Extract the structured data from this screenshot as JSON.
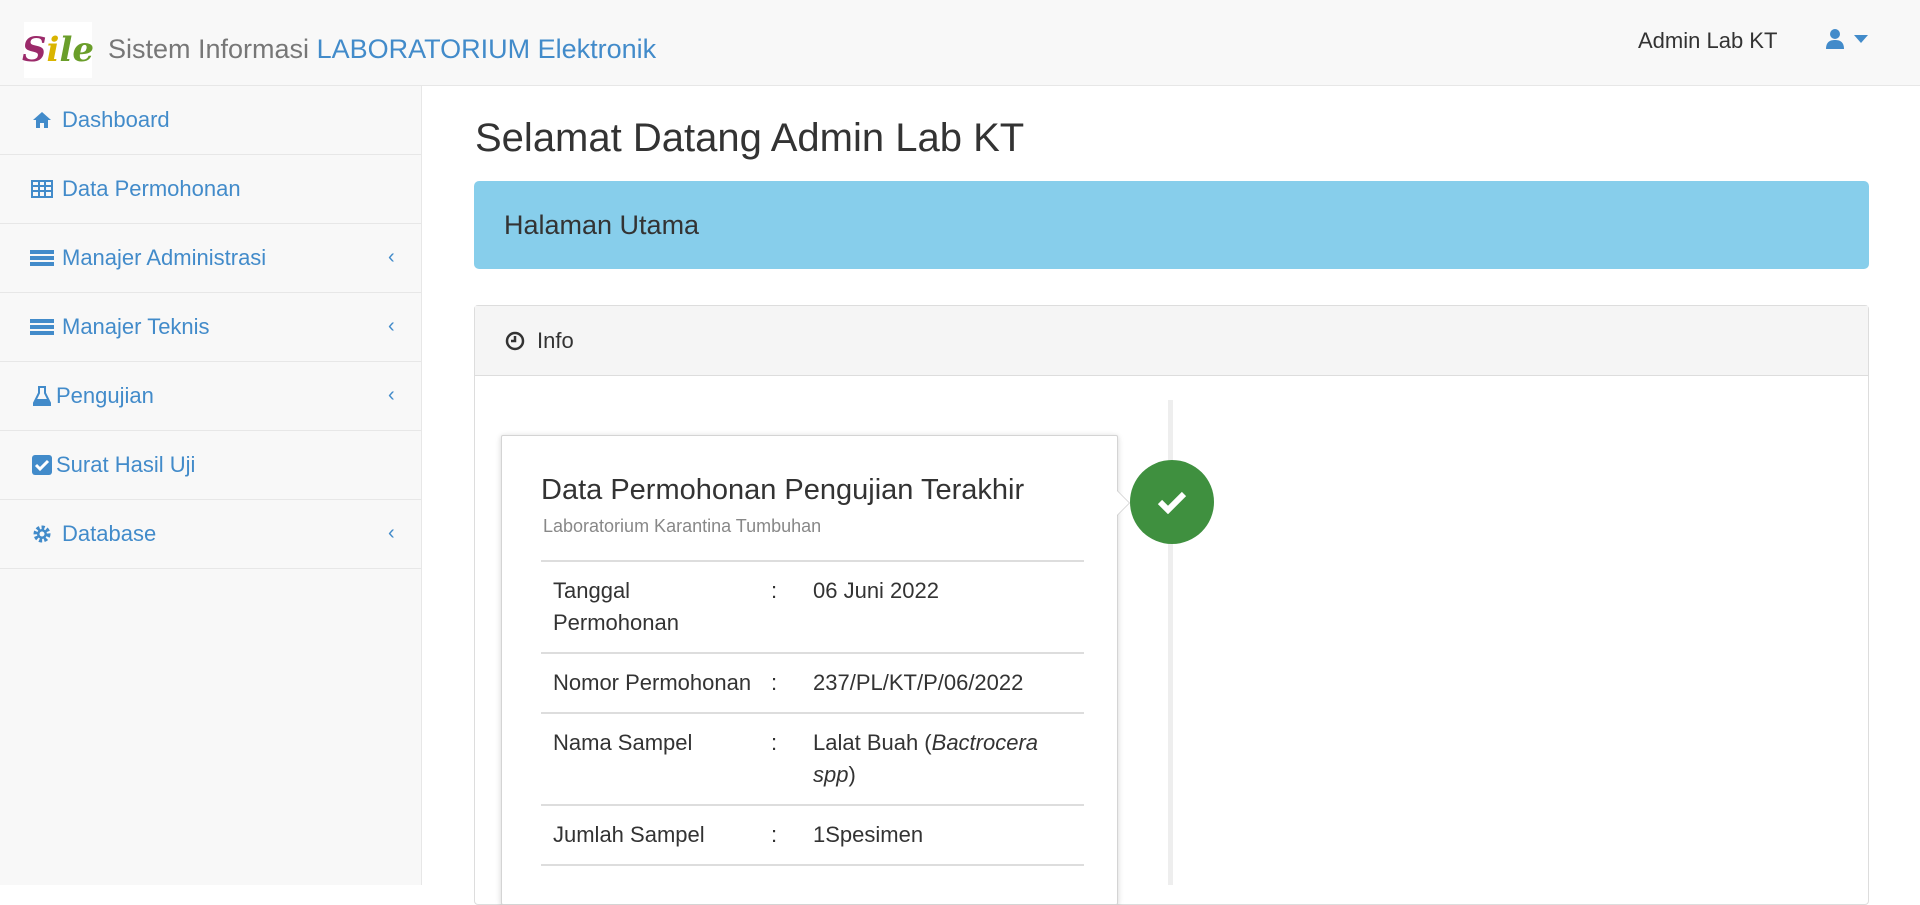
{
  "header": {
    "brand_prefix": "Sistem Informasi ",
    "brand_highlight": "LABORATORIUM Elektronik",
    "logo_text": "Sile",
    "user_name": "Admin Lab KT"
  },
  "sidebar": {
    "items": [
      {
        "label": "Dashboard",
        "icon": "home-icon",
        "submenu": false
      },
      {
        "label": "Data Permohonan",
        "icon": "table-icon",
        "submenu": false
      },
      {
        "label": "Manajer Administrasi",
        "icon": "tasks-icon",
        "submenu": true
      },
      {
        "label": "Manajer Teknis",
        "icon": "tasks-icon",
        "submenu": true
      },
      {
        "label": "Pengujian",
        "icon": "flask-icon",
        "submenu": true
      },
      {
        "label": "Surat Hasil Uji",
        "icon": "check-square-icon",
        "submenu": false
      },
      {
        "label": "Database",
        "icon": "gear-icon",
        "submenu": true
      }
    ]
  },
  "main": {
    "title": "Selamat Datang Admin Lab KT",
    "banner": "Halaman Utama",
    "panel_title": "Info",
    "card": {
      "title": "Data Permohonan Pengujian Terakhir",
      "subtitle": "Laboratorium Karantina Tumbuhan",
      "rows": [
        {
          "label": "Tanggal Permohonan",
          "sep": ":",
          "value": "06 Juni 2022"
        },
        {
          "label": "Nomor Permohonan",
          "sep": ":",
          "value": "237/PL/KT/P/06/2022"
        },
        {
          "label": "Nama Sampel",
          "sep": ":",
          "value": "Lalat Buah (",
          "value_italic": "Bactrocera spp",
          "value_end": ")"
        },
        {
          "label": "Jumlah Sampel",
          "sep": ":",
          "value": "1Spesimen"
        }
      ]
    }
  },
  "colors": {
    "accent": "#428bca",
    "banner": "#87ceeb",
    "success": "#3f903f"
  }
}
